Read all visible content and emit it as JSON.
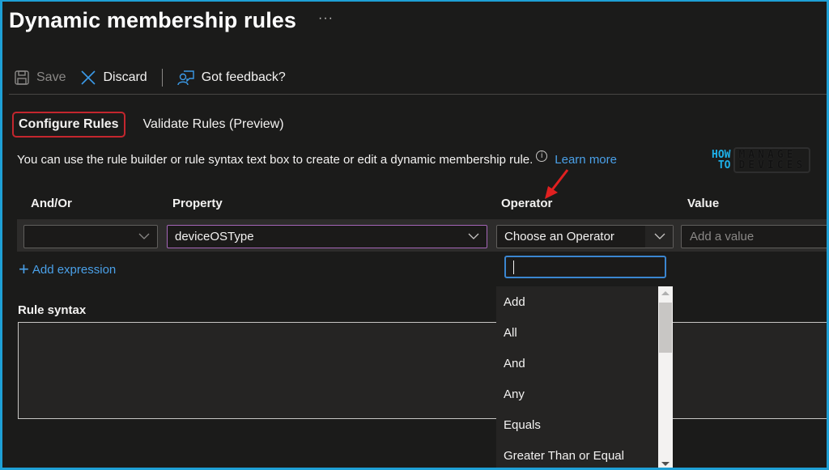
{
  "header": {
    "title": "Dynamic membership rules",
    "more_label": "···"
  },
  "toolbar": {
    "save_label": "Save",
    "discard_label": "Discard",
    "feedback_label": "Got feedback?"
  },
  "tabs": [
    {
      "label": "Configure Rules",
      "active": true
    },
    {
      "label": "Validate Rules (Preview)",
      "active": false
    }
  ],
  "description": {
    "text": "You can use the rule builder or rule syntax text box to create or edit a dynamic membership rule.",
    "info_icon": "i",
    "learn_more": "Learn more"
  },
  "watermark": {
    "how": "HOW",
    "to": "TO",
    "manage": "MANAGE",
    "devices": "DEVICES"
  },
  "columns": {
    "and_or": "And/Or",
    "property": "Property",
    "operator": "Operator",
    "value": "Value"
  },
  "rule_row": {
    "and_or_value": "",
    "property_value": "deviceOSType",
    "operator_value": "Choose an Operator",
    "value_placeholder": "Add a value"
  },
  "add_expression": {
    "icon": "+",
    "label": "Add expression"
  },
  "rule_syntax": {
    "label": "Rule syntax",
    "value": ""
  },
  "operator_dropdown": {
    "search_value": "",
    "items": [
      "Add",
      "All",
      "And",
      "Any",
      "Equals",
      "Greater Than or Equal"
    ]
  },
  "colors": {
    "accent_blue": "#4aa0e8",
    "active_tab_outline": "#c4262e",
    "property_focus": "#a566b8",
    "frame": "#1ea0d6"
  }
}
